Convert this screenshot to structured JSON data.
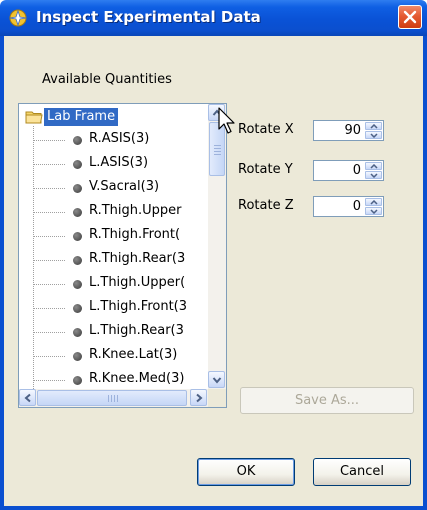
{
  "window": {
    "title": "Inspect Experimental Data",
    "colors": {
      "title_bar": "#0a52d6",
      "body": "#ece9d8",
      "selection": "#316ac5",
      "close_button": "#e55a32"
    }
  },
  "quantities": {
    "label": "Available Quantities",
    "root": "Lab Frame",
    "items": [
      "R.ASIS(3)",
      "L.ASIS(3)",
      "V.Sacral(3)",
      "R.Thigh.Upper",
      "R.Thigh.Front(",
      "R.Thigh.Rear(3",
      "L.Thigh.Upper(",
      "L.Thigh.Front(3",
      "L.Thigh.Rear(3",
      "R.Knee.Lat(3)",
      "R.Knee.Med(3)"
    ]
  },
  "rotation": {
    "x": {
      "label": "Rotate X",
      "value": "90"
    },
    "y": {
      "label": "Rotate Y",
      "value": "0"
    },
    "z": {
      "label": "Rotate Z",
      "value": "0"
    }
  },
  "buttons": {
    "save_as": "Save As...",
    "ok": "OK",
    "cancel": "Cancel"
  },
  "icons": {
    "title": "app-icon",
    "close": "close-icon",
    "folder": "folder-icon",
    "bullet": "bullet-icon",
    "cursor": "mouse-cursor-icon"
  }
}
